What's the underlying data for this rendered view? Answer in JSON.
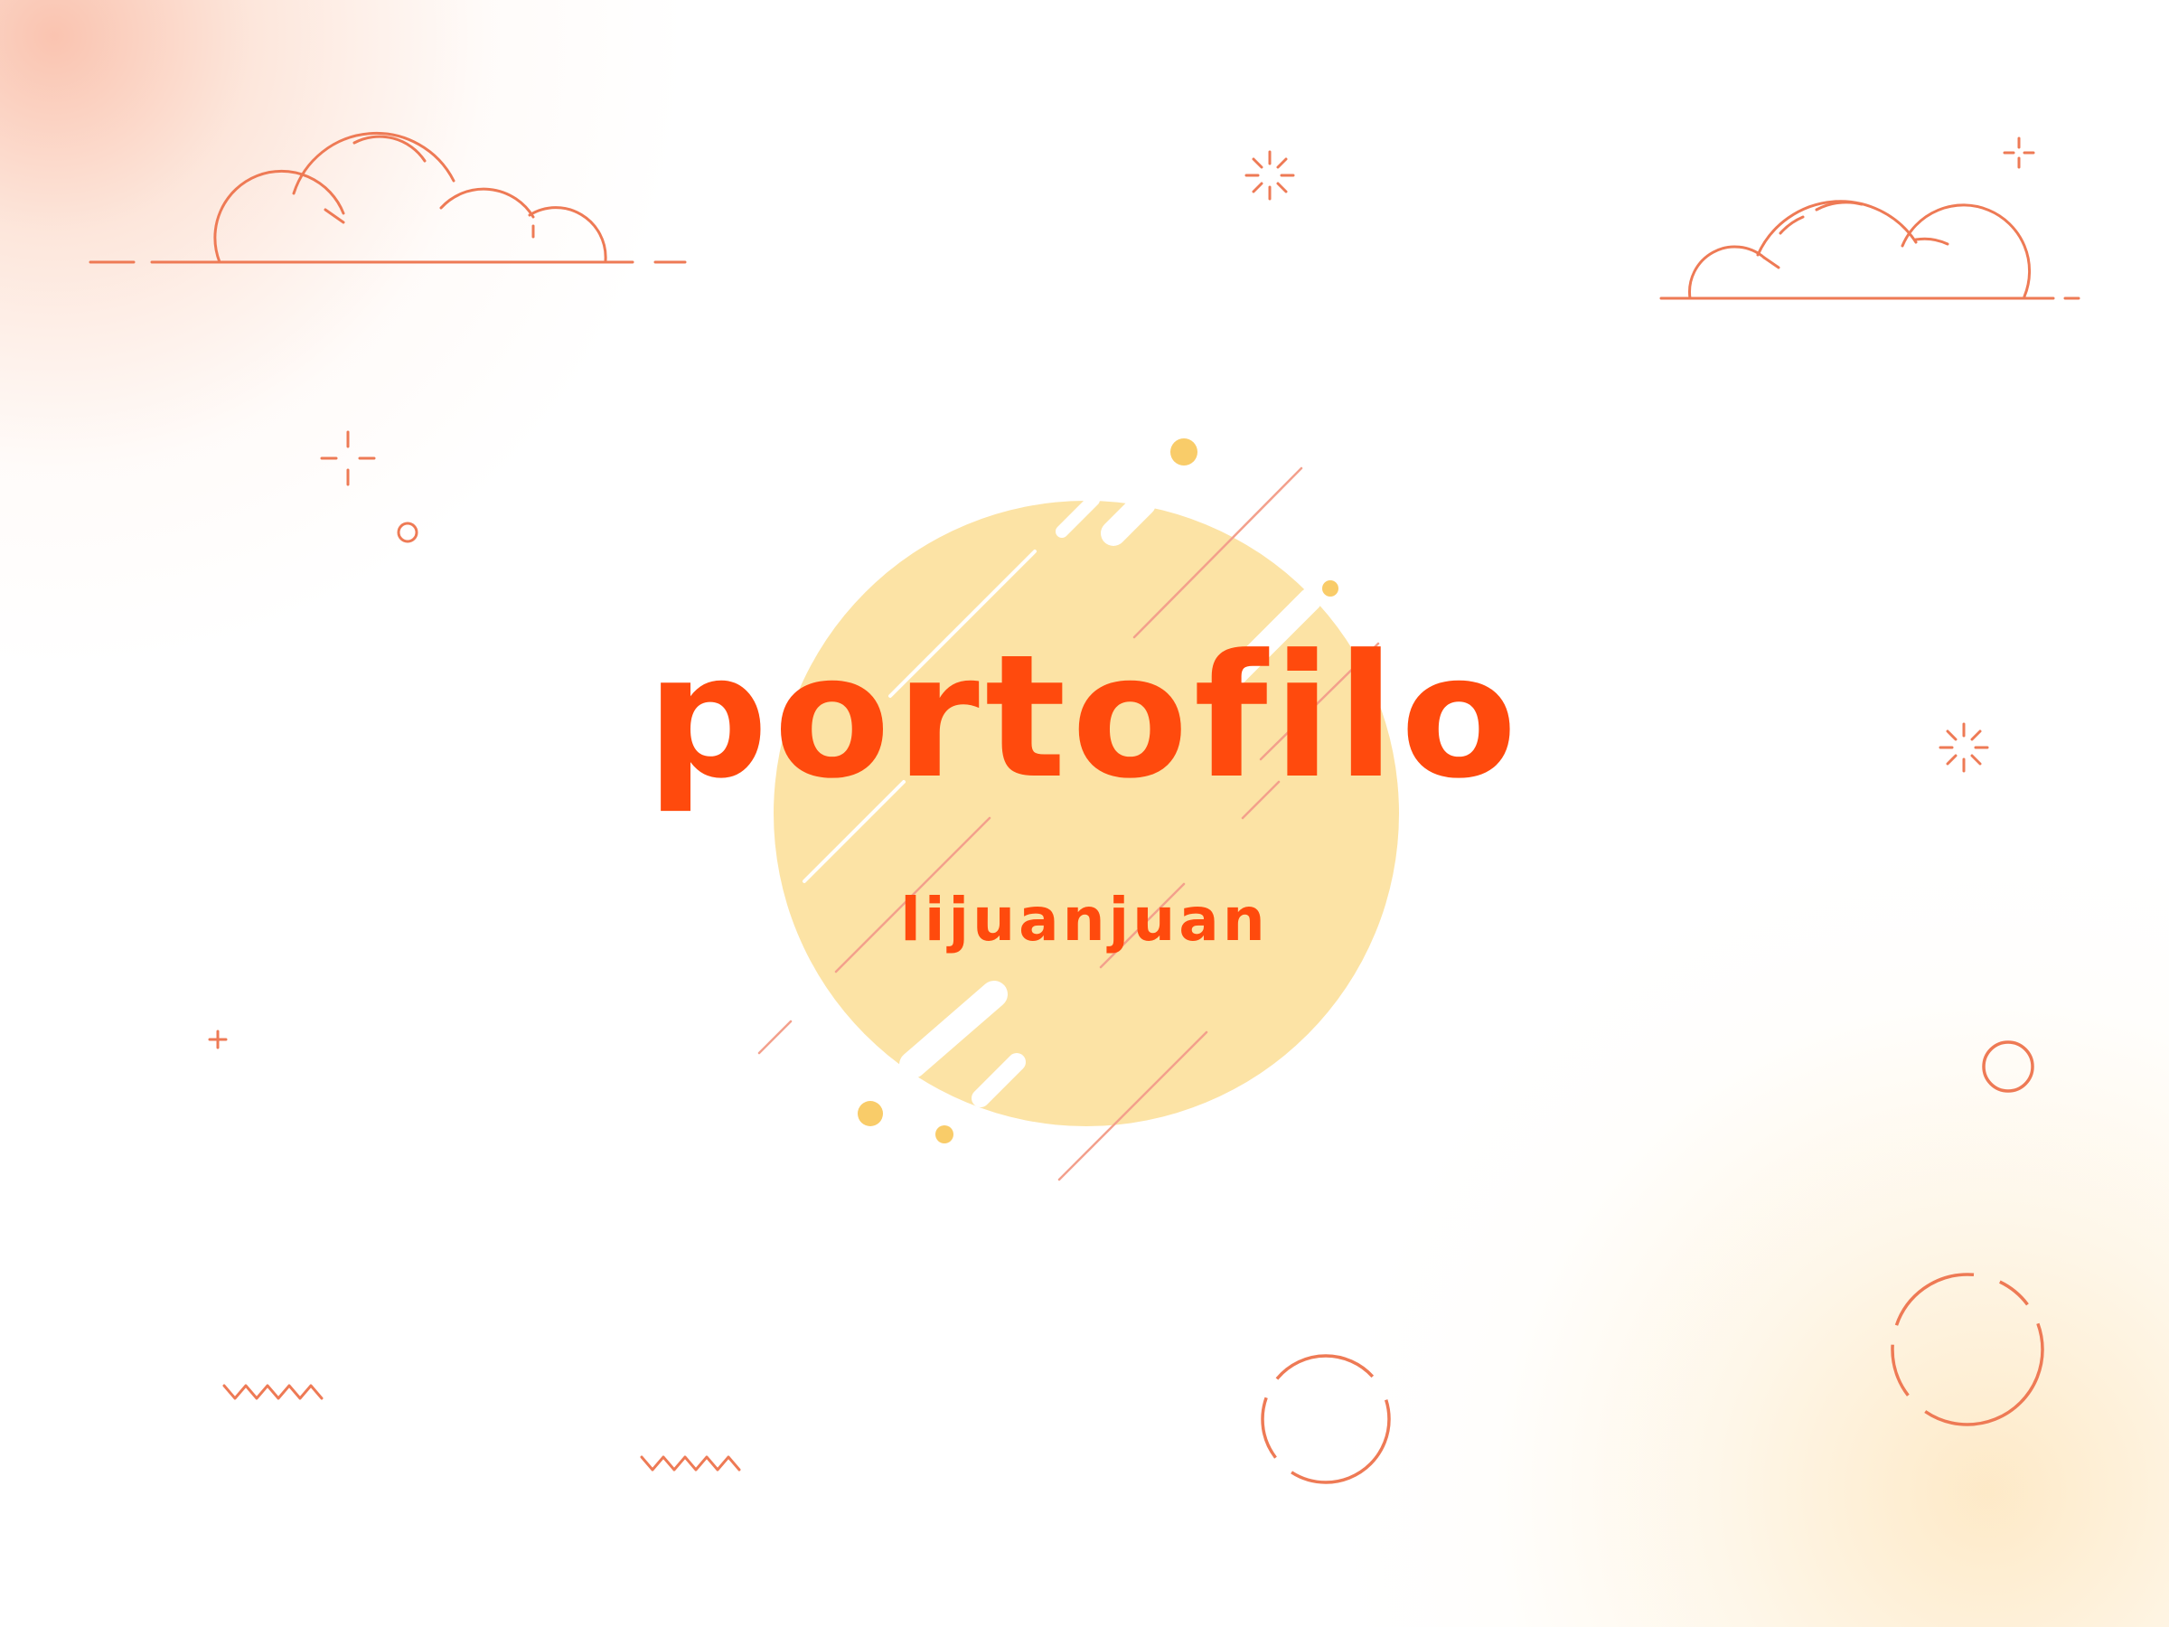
{
  "cover": {
    "title": "portofilo",
    "subtitle": "lijuanjuan"
  },
  "colors": {
    "accent": "#ff4a0d",
    "line": "#ee7a55",
    "sun": "#fce3a5",
    "sun_dot": "#f9cc69",
    "background": "#ffffff"
  },
  "icons": [
    "cloud-icon",
    "sparkle-icon",
    "plus-icon",
    "zigzag-icon",
    "ring-icon",
    "dashed-ring-icon"
  ]
}
